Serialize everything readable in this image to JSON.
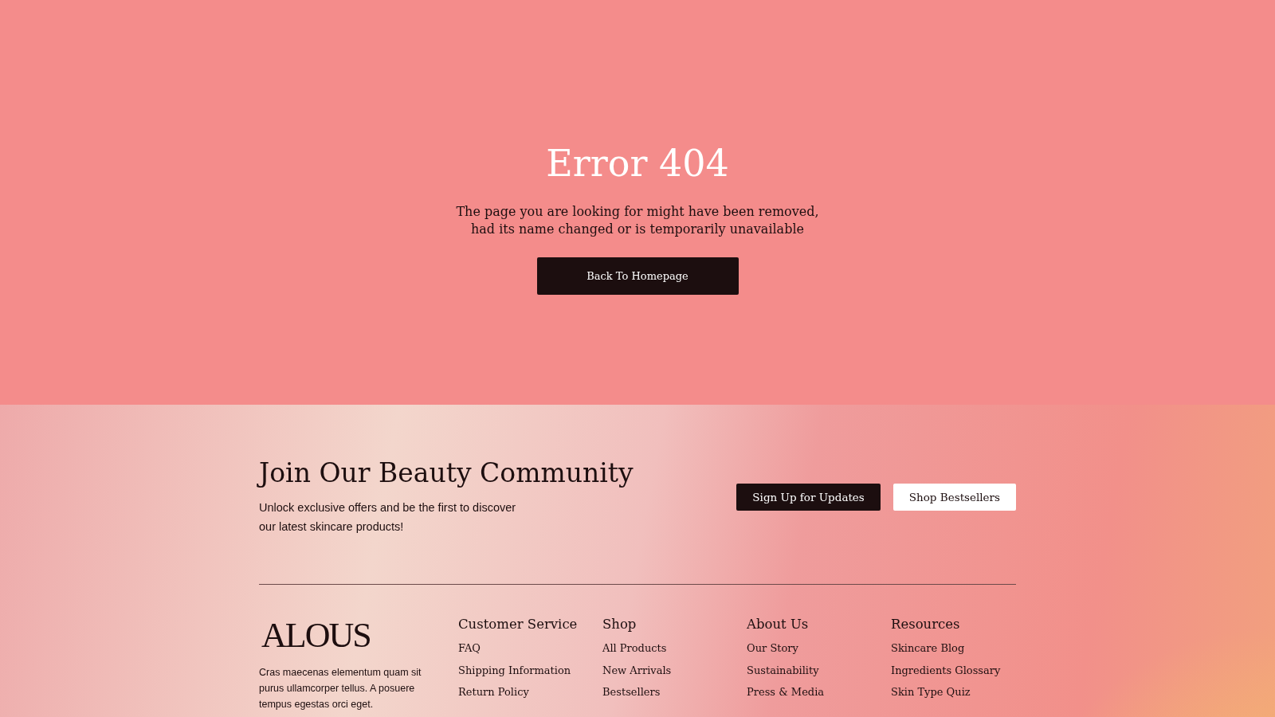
{
  "error": {
    "title": "Error 404",
    "message_lines": [
      "The page you are looking for might have been removed,",
      "had its name changed or is temporarily unavailable"
    ],
    "button": "Back To Homepage"
  },
  "newsletter": {
    "title": "Join Our Beauty Community",
    "text_lines": [
      "Unlock exclusive offers and be the first to discover",
      "our latest skincare products!"
    ],
    "buttons": [
      {
        "label": "Sign Up for Updates",
        "kind": "dark"
      },
      {
        "label": "Shop Bestsellers",
        "kind": "light"
      }
    ]
  },
  "footer": {
    "logo": "ALOUS",
    "about": "Cras maecenas elementum quam sit purus ullamcorper tellus. A posuere tempus egestas orci eget.",
    "columns": [
      {
        "title": "Customer Service",
        "links": [
          "FAQ",
          "Shipping Information",
          "Return Policy"
        ]
      },
      {
        "title": "Shop",
        "links": [
          "All Products",
          "New Arrivals",
          "Bestsellers"
        ]
      },
      {
        "title": "About Us",
        "links": [
          "Our Story",
          "Sustainability",
          "Press & Media"
        ]
      },
      {
        "title": "Resources",
        "links": [
          "Skincare Blog",
          "Ingredients Glossary",
          "Skin Type Quiz"
        ]
      }
    ]
  }
}
